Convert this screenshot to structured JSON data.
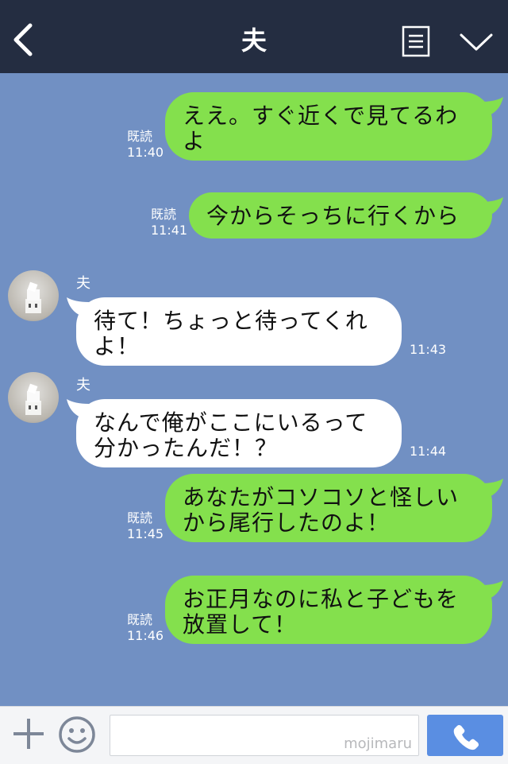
{
  "header": {
    "title": "夫"
  },
  "messages": {
    "m1": {
      "text": "ええ。すぐ近くで見てるわよ",
      "read": "既読",
      "time": "11:40"
    },
    "m2": {
      "text": "今からそっちに行くから",
      "read": "既読",
      "time": "11:41"
    },
    "m3": {
      "sender": "夫",
      "text": "待て！ちょっと待ってくれよ！",
      "time": "11:43"
    },
    "m4": {
      "sender": "夫",
      "text": "なんで俺がここにいるって分かったんだ！？",
      "time": "11:44"
    },
    "m5": {
      "text": "あなたがコソコソと怪しいから尾行したのよ！",
      "read": "既読",
      "time": "11:45"
    },
    "m6": {
      "text": "お正月なのに私と子どもを放置して！",
      "read": "既読",
      "time": "11:46"
    }
  },
  "composer": {
    "watermark": "mojimaru"
  },
  "colors": {
    "background": "#7190c3",
    "header": "#242d41",
    "outgoing_bubble": "#84e04d",
    "incoming_bubble": "#ffffff",
    "call_button": "#5a8ee2"
  },
  "icons": {
    "back": "chevron-left-icon",
    "menu": "list-icon",
    "collapse": "chevron-down-icon",
    "add": "plus-icon",
    "emoji": "smile-icon",
    "call": "phone-icon"
  }
}
